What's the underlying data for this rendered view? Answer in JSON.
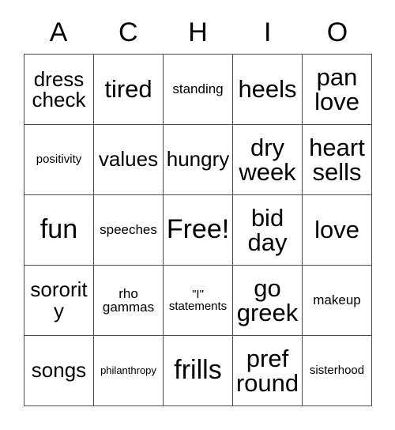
{
  "card": {
    "title_letters": [
      "A",
      "C",
      "H",
      "I",
      "O"
    ],
    "columns": 5,
    "rows": 5,
    "border_color": "#4d4d4d",
    "background_color": "#ffffff",
    "text_color": "#000000",
    "free_space": "Free!",
    "cells": [
      [
        {
          "text": "dress\ncheck",
          "size": "t-md"
        },
        {
          "text": "tired",
          "size": "t-lg"
        },
        {
          "text": "standing",
          "size": "t-sm"
        },
        {
          "text": "heels",
          "size": "t-lg"
        },
        {
          "text": "pan\nlove",
          "size": "t-lg"
        }
      ],
      [
        {
          "text": "positivity",
          "size": "t-xs"
        },
        {
          "text": "values",
          "size": "t-md"
        },
        {
          "text": "hungry",
          "size": "t-md"
        },
        {
          "text": "dry\nweek",
          "size": "t-lg"
        },
        {
          "text": "heart\nsells",
          "size": "t-lg"
        }
      ],
      [
        {
          "text": "fun",
          "size": "t-xl"
        },
        {
          "text": "speeches",
          "size": "t-sm"
        },
        {
          "text": "Free!",
          "size": "t-xl"
        },
        {
          "text": "bid\nday",
          "size": "t-lg"
        },
        {
          "text": "love",
          "size": "t-lg"
        }
      ],
      [
        {
          "text": "sorority",
          "size": "t-md"
        },
        {
          "text": "rho\ngammas",
          "size": "t-sm"
        },
        {
          "text": "\"I\"\nstatements",
          "size": "t-xs"
        },
        {
          "text": "go\ngreek",
          "size": "t-lg"
        },
        {
          "text": "makeup",
          "size": "t-sm"
        }
      ],
      [
        {
          "text": "songs",
          "size": "t-md"
        },
        {
          "text": "philanthropy",
          "size": "t-xxs"
        },
        {
          "text": "frills",
          "size": "t-xl"
        },
        {
          "text": "pref\nround",
          "size": "t-lg"
        },
        {
          "text": "sisterhood",
          "size": "t-xs"
        }
      ]
    ]
  }
}
